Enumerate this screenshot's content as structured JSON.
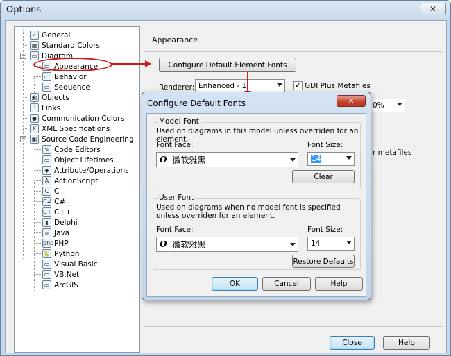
{
  "window": {
    "title": "Options",
    "close_glyph": "✕"
  },
  "tree": {
    "items": [
      {
        "label": "General",
        "icon": "general-icon"
      },
      {
        "label": "Standard Colors",
        "icon": "standard-colors-icon"
      },
      {
        "label": "Diagram",
        "icon": "diagram-icon",
        "expander": "−"
      },
      {
        "label": "Appearance",
        "icon": "appearance-icon"
      },
      {
        "label": "Behavior",
        "icon": "behavior-icon"
      },
      {
        "label": "Sequence",
        "icon": "sequence-icon"
      },
      {
        "label": "Objects",
        "icon": "objects-icon"
      },
      {
        "label": "Links",
        "icon": "links-icon"
      },
      {
        "label": "Communication Colors",
        "icon": "communication-colors-icon"
      },
      {
        "label": "XML Specifications",
        "icon": "xml-icon"
      },
      {
        "label": "Source Code Engineering",
        "icon": "source-code-icon",
        "expander": "−"
      },
      {
        "label": "Code Editors",
        "icon": "code-editors-icon"
      },
      {
        "label": "Object Lifetimes",
        "icon": "object-lifetimes-icon"
      },
      {
        "label": "Attribute/Operations",
        "icon": "attribute-operations-icon"
      },
      {
        "label": "ActionScript",
        "icon": "actionscript-icon"
      },
      {
        "label": "C",
        "icon": "c-icon"
      },
      {
        "label": "C#",
        "icon": "csharp-icon"
      },
      {
        "label": "C++",
        "icon": "cpp-icon"
      },
      {
        "label": "Delphi",
        "icon": "delphi-icon"
      },
      {
        "label": "Java",
        "icon": "java-icon"
      },
      {
        "label": "PHP",
        "icon": "php-icon"
      },
      {
        "label": "Python",
        "icon": "python-icon"
      },
      {
        "label": "Visual Basic",
        "icon": "visual-basic-icon"
      },
      {
        "label": "VB.Net",
        "icon": "vbnet-icon"
      },
      {
        "label": "ArcGIS",
        "icon": "arcgis-icon"
      }
    ],
    "icon_glyphs": [
      "✓",
      "▦",
      "▭",
      "▭",
      "▭",
      "▭",
      "▣",
      "",
      "●",
      "X",
      "▣",
      "✎",
      "▭",
      "◆",
      "A",
      "C",
      "C#",
      "C+",
      "▮",
      "☕",
      "php",
      "🐍",
      "▭",
      "▭",
      "▭"
    ]
  },
  "appearance_page": {
    "heading": "Appearance",
    "configure_button": "Configure Default Element Fonts",
    "renderer_label": "Renderer:",
    "renderer_value": "Enhanced - 1",
    "gdi_label": "GDI Plus Metafiles",
    "gdi_checked": true,
    "zoom_value": "0%",
    "metafiles_fragment": "r metafiles",
    "checkmark": "✓"
  },
  "dialog": {
    "title": "Configure Default Fonts",
    "close_glyph": "✕",
    "model_font": {
      "group_title": "Model Font",
      "description": "Used on diagrams in this model unless overriden for an element.",
      "face_label": "Font Face:",
      "face_value": "微软雅黑",
      "face_icon": "O",
      "size_label": "Font Size:",
      "size_value": "14",
      "clear_button": "Clear"
    },
    "user_font": {
      "group_title": "User Font",
      "description": "Used on diagrams when no model font is specified unless overriden for an element.",
      "face_label": "Font Face:",
      "face_value": "微软雅黑",
      "face_icon": "O",
      "size_label": "Font Size:",
      "size_value": "14",
      "restore_button": "Restore Defaults"
    },
    "ok_button": "OK",
    "cancel_button": "Cancel",
    "help_button": "Help"
  },
  "footer": {
    "close_button": "Close",
    "help_button": "Help"
  },
  "colors": {
    "annotation_red": "#d01818",
    "title_bar": "#c7d9ec",
    "dialog_close": "#c6452d"
  }
}
